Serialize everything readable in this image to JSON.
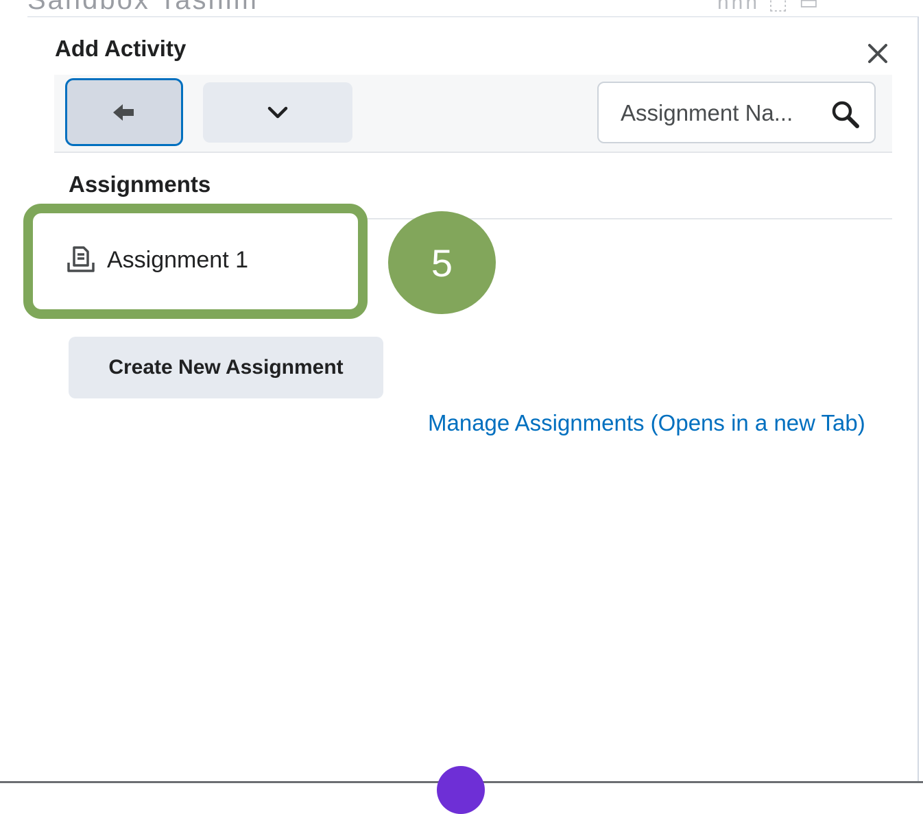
{
  "background": {
    "cut_off_text": "Sandbox Tasnim",
    "cut_off_right": "nnn ⬚ ▭"
  },
  "dialog": {
    "title": "Add Activity",
    "close_icon": "close-icon"
  },
  "toolbar": {
    "back_icon": "arrow-left-icon",
    "dropdown_icon": "chevron-down-icon",
    "search": {
      "placeholder": "Assignment Na...",
      "value": "",
      "icon": "search-icon"
    }
  },
  "assignments": {
    "heading": "Assignments",
    "items": [
      {
        "label": "Assignment 1",
        "icon": "assignment-icon"
      }
    ],
    "create_button": "Create New Assignment",
    "manage_link": "Manage Assignments (Opens in a new Tab)"
  },
  "annotation": {
    "step_number": "5",
    "color": "#82a65b"
  },
  "colors": {
    "accent": "#006fbf",
    "highlight": "#7fa75a",
    "button_bg": "#e6eaf0"
  }
}
